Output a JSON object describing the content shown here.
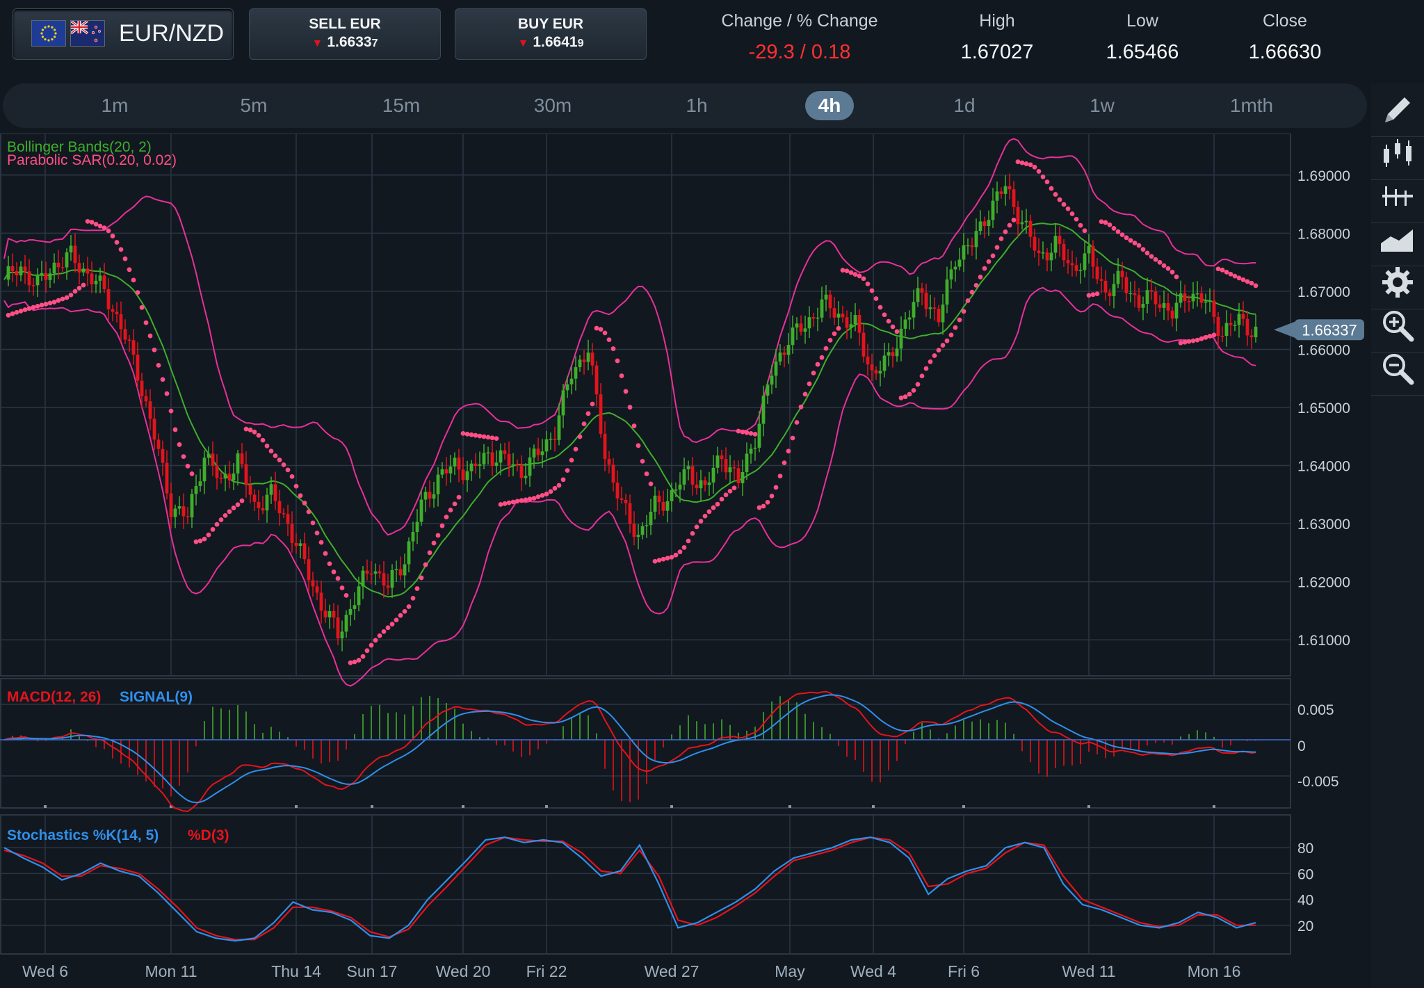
{
  "instrument": {
    "pair": "EUR/NZD",
    "flag_left": "eu-flag",
    "flag_right": "nz-flag"
  },
  "sell": {
    "label": "SELL EUR",
    "price_main": "1.6633",
    "price_pip": "7"
  },
  "buy": {
    "label": "BUY EUR",
    "price_main": "1.6641",
    "price_pip": "9"
  },
  "stats": {
    "change_label": "Change / % Change",
    "change_value": "-29.3 / 0.18",
    "high_label": "High",
    "high_value": "1.67027",
    "low_label": "Low",
    "low_value": "1.65466",
    "close_label": "Close",
    "close_value": "1.66630"
  },
  "timeframes": [
    "1m",
    "5m",
    "15m",
    "30m",
    "1h",
    "4h",
    "1d",
    "1w",
    "1mth"
  ],
  "active_timeframe": "4h",
  "toolbar": [
    "pencil-icon",
    "candlestick-icon",
    "indicator-icon",
    "area-chart-icon",
    "gear-icon",
    "zoom-in-icon",
    "zoom-out-icon"
  ],
  "colors": {
    "bg": "#121820",
    "grid": "#2a3644",
    "bull": "#3fae2c",
    "bear": "#e3141c",
    "bollinger_outer": "#e8309a",
    "bollinger_mid": "#3fae2c",
    "sar": "#ff4f86",
    "macd": "#e3141c",
    "signal": "#2f8fea",
    "stoch_k": "#2f8fea",
    "stoch_d": "#e3141c"
  },
  "chart_data": {
    "type": "candlestick",
    "price_axis": {
      "ticks": [
        "1.69000",
        "1.68000",
        "1.67000",
        "1.66000",
        "1.65000",
        "1.64000",
        "1.63000",
        "1.62000",
        "1.61000"
      ],
      "ylim": [
        1.605,
        1.695
      ],
      "current_price": "1.66337"
    },
    "x_ticks": [
      "Wed 6",
      "Mon 11",
      "Thu 14",
      "Sun 17",
      "Wed 20",
      "Fri 22",
      "Wed 27",
      "May",
      "Wed 4",
      "Fri 6",
      "Wed 11",
      "Mon 16"
    ],
    "indicators": {
      "bollinger": "Bollinger Bands(20, 2)",
      "sar": "Parabolic SAR(0.20, 0.02)"
    },
    "close_path": [
      [
        0,
        1.672
      ],
      [
        4,
        1.674
      ],
      [
        8,
        1.671
      ],
      [
        12,
        1.6745
      ],
      [
        16,
        1.676
      ],
      [
        20,
        1.673
      ],
      [
        24,
        1.67
      ],
      [
        28,
        1.664
      ],
      [
        32,
        1.656
      ],
      [
        36,
        1.645
      ],
      [
        40,
        1.633
      ],
      [
        44,
        1.631
      ],
      [
        48,
        1.642
      ],
      [
        52,
        1.637
      ],
      [
        56,
        1.641
      ],
      [
        60,
        1.633
      ],
      [
        64,
        1.635
      ],
      [
        68,
        1.63
      ],
      [
        72,
        1.623
      ],
      [
        76,
        1.616
      ],
      [
        80,
        1.611
      ],
      [
        84,
        1.617
      ],
      [
        88,
        1.623
      ],
      [
        92,
        1.619
      ],
      [
        96,
        1.624
      ],
      [
        100,
        1.633
      ],
      [
        104,
        1.638
      ],
      [
        108,
        1.64
      ],
      [
        112,
        1.639
      ],
      [
        116,
        1.642
      ],
      [
        120,
        1.641
      ],
      [
        124,
        1.639
      ],
      [
        128,
        1.642
      ],
      [
        132,
        1.646
      ],
      [
        136,
        1.656
      ],
      [
        140,
        1.66
      ],
      [
        144,
        1.642
      ],
      [
        148,
        1.633
      ],
      [
        152,
        1.628
      ],
      [
        156,
        1.633
      ],
      [
        160,
        1.635
      ],
      [
        164,
        1.639
      ],
      [
        168,
        1.636
      ],
      [
        172,
        1.642
      ],
      [
        176,
        1.637
      ],
      [
        180,
        1.645
      ],
      [
        184,
        1.656
      ],
      [
        188,
        1.662
      ],
      [
        192,
        1.664
      ],
      [
        196,
        1.668
      ],
      [
        200,
        1.666
      ],
      [
        204,
        1.664
      ],
      [
        208,
        1.656
      ],
      [
        212,
        1.658
      ],
      [
        216,
        1.665
      ],
      [
        220,
        1.67
      ],
      [
        224,
        1.665
      ],
      [
        228,
        1.676
      ],
      [
        232,
        1.678
      ],
      [
        236,
        1.684
      ],
      [
        240,
        1.688
      ],
      [
        244,
        1.682
      ],
      [
        248,
        1.676
      ],
      [
        252,
        1.678
      ],
      [
        256,
        1.674
      ],
      [
        260,
        1.676
      ],
      [
        264,
        1.67
      ],
      [
        268,
        1.672
      ],
      [
        272,
        1.668
      ],
      [
        276,
        1.669
      ],
      [
        280,
        1.666
      ],
      [
        284,
        1.67
      ],
      [
        288,
        1.668
      ],
      [
        292,
        1.663
      ],
      [
        296,
        1.665
      ],
      [
        300,
        1.663
      ]
    ],
    "macd_panel": {
      "label_macd": "MACD(12, 26)",
      "label_signal": "SIGNAL(9)",
      "ticks": [
        "0.005",
        "0",
        "-0.005"
      ]
    },
    "stoch_panel": {
      "label_k": "Stochastics %K(14, 5)",
      "label_d": "%D(3)",
      "ticks": [
        "80",
        "60",
        "40",
        "20"
      ],
      "ylim": [
        0,
        100
      ],
      "k": [
        80,
        72,
        65,
        55,
        60,
        68,
        62,
        58,
        45,
        30,
        15,
        10,
        8,
        10,
        22,
        38,
        32,
        30,
        24,
        12,
        10,
        20,
        40,
        55,
        70,
        86,
        88,
        84,
        86,
        84,
        72,
        58,
        62,
        82,
        52,
        18,
        22,
        30,
        38,
        48,
        62,
        72,
        76,
        80,
        86,
        88,
        84,
        72,
        44,
        56,
        62,
        66,
        80,
        84,
        80,
        52,
        36,
        32,
        26,
        20,
        18,
        22,
        30,
        26,
        18,
        22
      ],
      "d": [
        78,
        74,
        68,
        58,
        58,
        66,
        64,
        60,
        48,
        34,
        18,
        12,
        9,
        9,
        18,
        34,
        34,
        31,
        26,
        15,
        11,
        17,
        35,
        50,
        66,
        82,
        88,
        86,
        85,
        85,
        76,
        62,
        60,
        78,
        58,
        24,
        20,
        26,
        35,
        45,
        58,
        70,
        74,
        78,
        84,
        88,
        86,
        76,
        50,
        52,
        60,
        64,
        76,
        84,
        82,
        58,
        40,
        34,
        28,
        22,
        19,
        20,
        28,
        28,
        20,
        20
      ]
    }
  }
}
